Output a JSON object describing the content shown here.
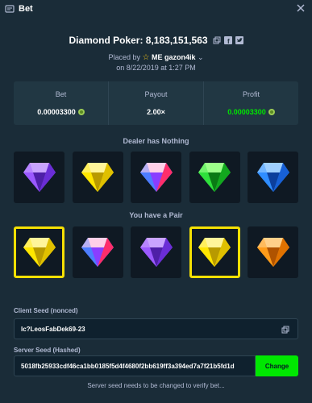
{
  "header": {
    "title": "Bet",
    "icon": "ticket-icon",
    "close_icon": "close-icon"
  },
  "game": {
    "title": "Diamond Poker: 8,183,151,563",
    "placed_prefix": "Placed by",
    "user": "ME gazon4ik",
    "date": "on 8/22/2019 at 1:27 PM"
  },
  "stats": [
    {
      "label": "Bet",
      "value": "0.00003300",
      "color": "#ffffff"
    },
    {
      "label": "Payout",
      "value": "2.00×",
      "color": "#ffffff"
    },
    {
      "label": "Profit",
      "value": "0.00003300",
      "color": "#00e701"
    }
  ],
  "dealer": {
    "label": "Dealer has Nothing",
    "gems": [
      {
        "name": "purple-gem",
        "color": "purple",
        "win": false
      },
      {
        "name": "yellow-gem",
        "color": "yellow",
        "win": false
      },
      {
        "name": "multi-gem",
        "color": "multi",
        "win": false
      },
      {
        "name": "green-gem",
        "color": "green",
        "win": false
      },
      {
        "name": "blue-gem",
        "color": "blue",
        "win": false
      }
    ]
  },
  "player": {
    "label": "You have a Pair",
    "gems": [
      {
        "name": "yellow-gem",
        "color": "yellow",
        "win": true
      },
      {
        "name": "multi-gem",
        "color": "multi",
        "win": false
      },
      {
        "name": "purple-gem",
        "color": "purple",
        "win": false
      },
      {
        "name": "yellow-gem",
        "color": "yellow",
        "win": true
      },
      {
        "name": "orange-gem",
        "color": "orange",
        "win": false
      }
    ]
  },
  "seeds": {
    "client_label": "Client Seed (nonced)",
    "client_value": "lc?LeosFabDek69-23",
    "server_label": "Server Seed (Hashed)",
    "server_value": "5018fb25933cdf46ca1bb0185f5d4f4680f2bb619ff3a394ed7a7f21b5fd1d",
    "change_label": "Change",
    "note": "Server seed needs to be changed to verify bet..."
  },
  "colors": {
    "background": "#1a2c38",
    "panel": "#213743",
    "accent_green": "#00e701",
    "win_border": "#f5e003"
  }
}
